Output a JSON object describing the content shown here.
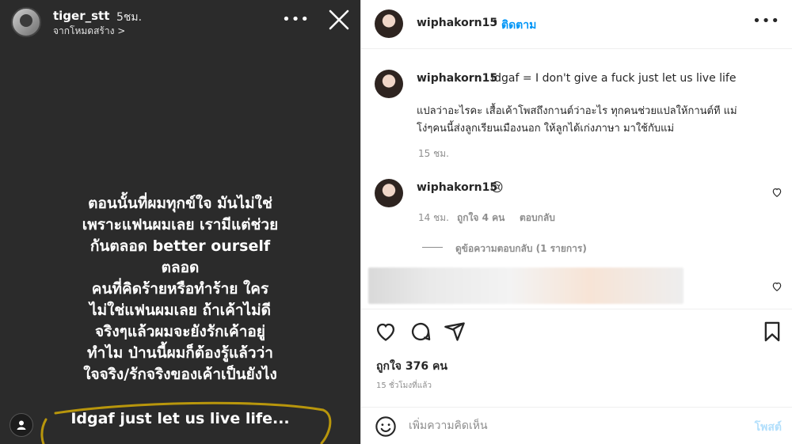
{
  "story": {
    "username": "tiger_stt",
    "time": "5ชม.",
    "subtitle": "จากโหมดสร้าง >",
    "more": "•••",
    "text_lines": [
      "ตอนนั้นที่ผมทุกข์ใจ มันไม่ใช่",
      "เพราะแฟนผมเลย เรามีแต่ช่วย",
      "กันตลอด better ourself",
      "ตลอด",
      "คนที่คิดร้ายหรือทำร้าย ใคร",
      "ไม่ใช่แฟนผมเลย ถ้าเค้าไม่ดี",
      "จริงๆแล้วผมจะยังรักเค้าอยู่",
      "ทำไม ป่านนี้ผมก็ต้องรู้แล้วว่า",
      "ใจจริง/รักจริงของเค้าเป็นยังไง"
    ],
    "caption": "Idgaf just let us live life...",
    "scribble_color": "#b8960c"
  },
  "post": {
    "username": "wiphakorn15",
    "dot": "•",
    "follow_label": "ติดตาม",
    "more": "•••",
    "caption": {
      "username": "wiphakorn15",
      "text": "Idgaf = I don't give a fuck just let us live life",
      "reply_line1": "แปลว่าอะไรคะ เสื้อเค้าโพสถึงกานต์ว่าอะไร ทุกคนช่วยแปลให้กานต์ที แม่",
      "reply_line2": "โง่ๆคนนี้ส่งลูกเรียนเมืองนอก ให้ลูกได้เก่งภาษา มาใช้กับแม่",
      "time": "15 ชม."
    },
    "comment": {
      "username": "wiphakorn15",
      "emoji": "😢",
      "time": "14 ชม.",
      "likes": "ถูกใจ 4 คน",
      "reply": "ตอบกลับ",
      "view_replies": "ดูข้อความตอบกลับ (1 รายการ)"
    },
    "likes_count": "ถูกใจ 376 คน",
    "posted_ago": "15 ชั่วโมงที่แล้ว",
    "comment_placeholder": "เพิ่มความคิดเห็น",
    "post_label": "โพสต์",
    "accent_color": "#0095f6"
  }
}
